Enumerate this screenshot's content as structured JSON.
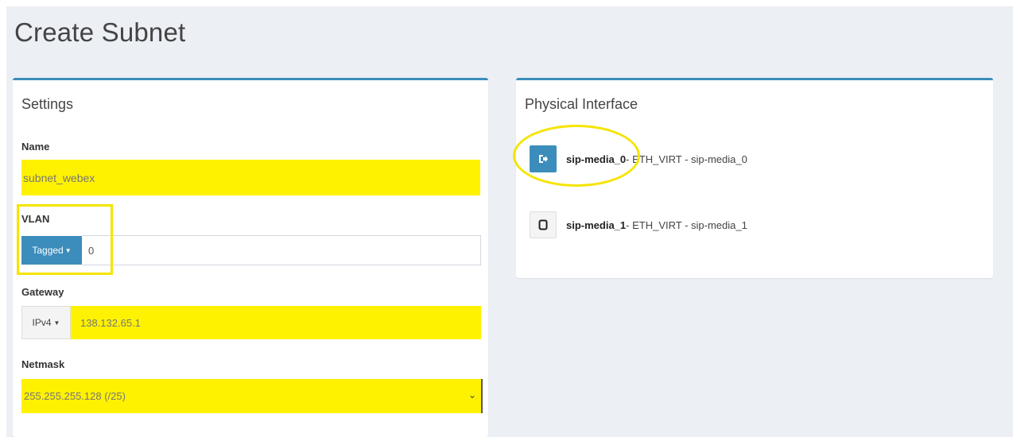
{
  "page": {
    "title": "Create Subnet"
  },
  "settings": {
    "header": "Settings",
    "name": {
      "label": "Name",
      "value": "subnet_webex"
    },
    "vlan": {
      "label": "VLAN",
      "mode_label": "Tagged",
      "value": "0"
    },
    "gateway": {
      "label": "Gateway",
      "ip_version_label": "IPv4",
      "value": "138.132.65.1"
    },
    "netmask": {
      "label": "Netmask",
      "selected": "255.255.255.128 (/25)"
    }
  },
  "physical_interface": {
    "header": "Physical Interface",
    "items": [
      {
        "name": "sip-media_0",
        "detail": " - ETH_VIRT - sip-media_0",
        "selected": true,
        "icon": "sign-out-icon"
      },
      {
        "name": "sip-media_1",
        "detail": " - ETH_VIRT - sip-media_1",
        "selected": false,
        "icon": "square-icon"
      }
    ]
  },
  "colors": {
    "accent": "#3c8dbc",
    "highlight": "#fff200",
    "annotation": "#f5e400",
    "background": "#eceff4"
  }
}
